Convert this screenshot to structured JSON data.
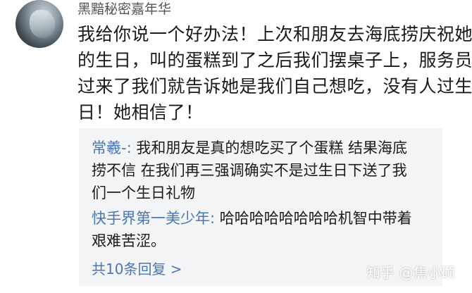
{
  "comment": {
    "username": "黑黯秘密嘉年华",
    "content_lines": [
      "我给你说一个好办法！上次和朋友去海底捞庆祝她",
      "的生日，叫的蛋糕到了之后我们摆桌子上，服务员",
      "过来了我们就告诉她是我们自己想吃，没有人过生",
      "日！她相信了！"
    ]
  },
  "replies": [
    {
      "author": "常羲-: ",
      "lines": [
        "我和朋友是真的想吃买了个蛋糕 结果海底",
        "捞不信 在我们再三强调确实不是过生日下送了我",
        "们一个生日礼物"
      ]
    },
    {
      "author": "快手界第一美少年: ",
      "lines": [
        "哈哈哈哈哈哈哈哈机智中带着",
        "艰难苦涩。"
      ]
    }
  ],
  "more_replies_label": "共10条回复 >",
  "watermark": "知乎 @焦小硕",
  "colors": {
    "author_link": "#4a77b3",
    "reply_background": "#f3f4f6",
    "body_text": "#1a1a1a",
    "username_text": "#555555"
  }
}
